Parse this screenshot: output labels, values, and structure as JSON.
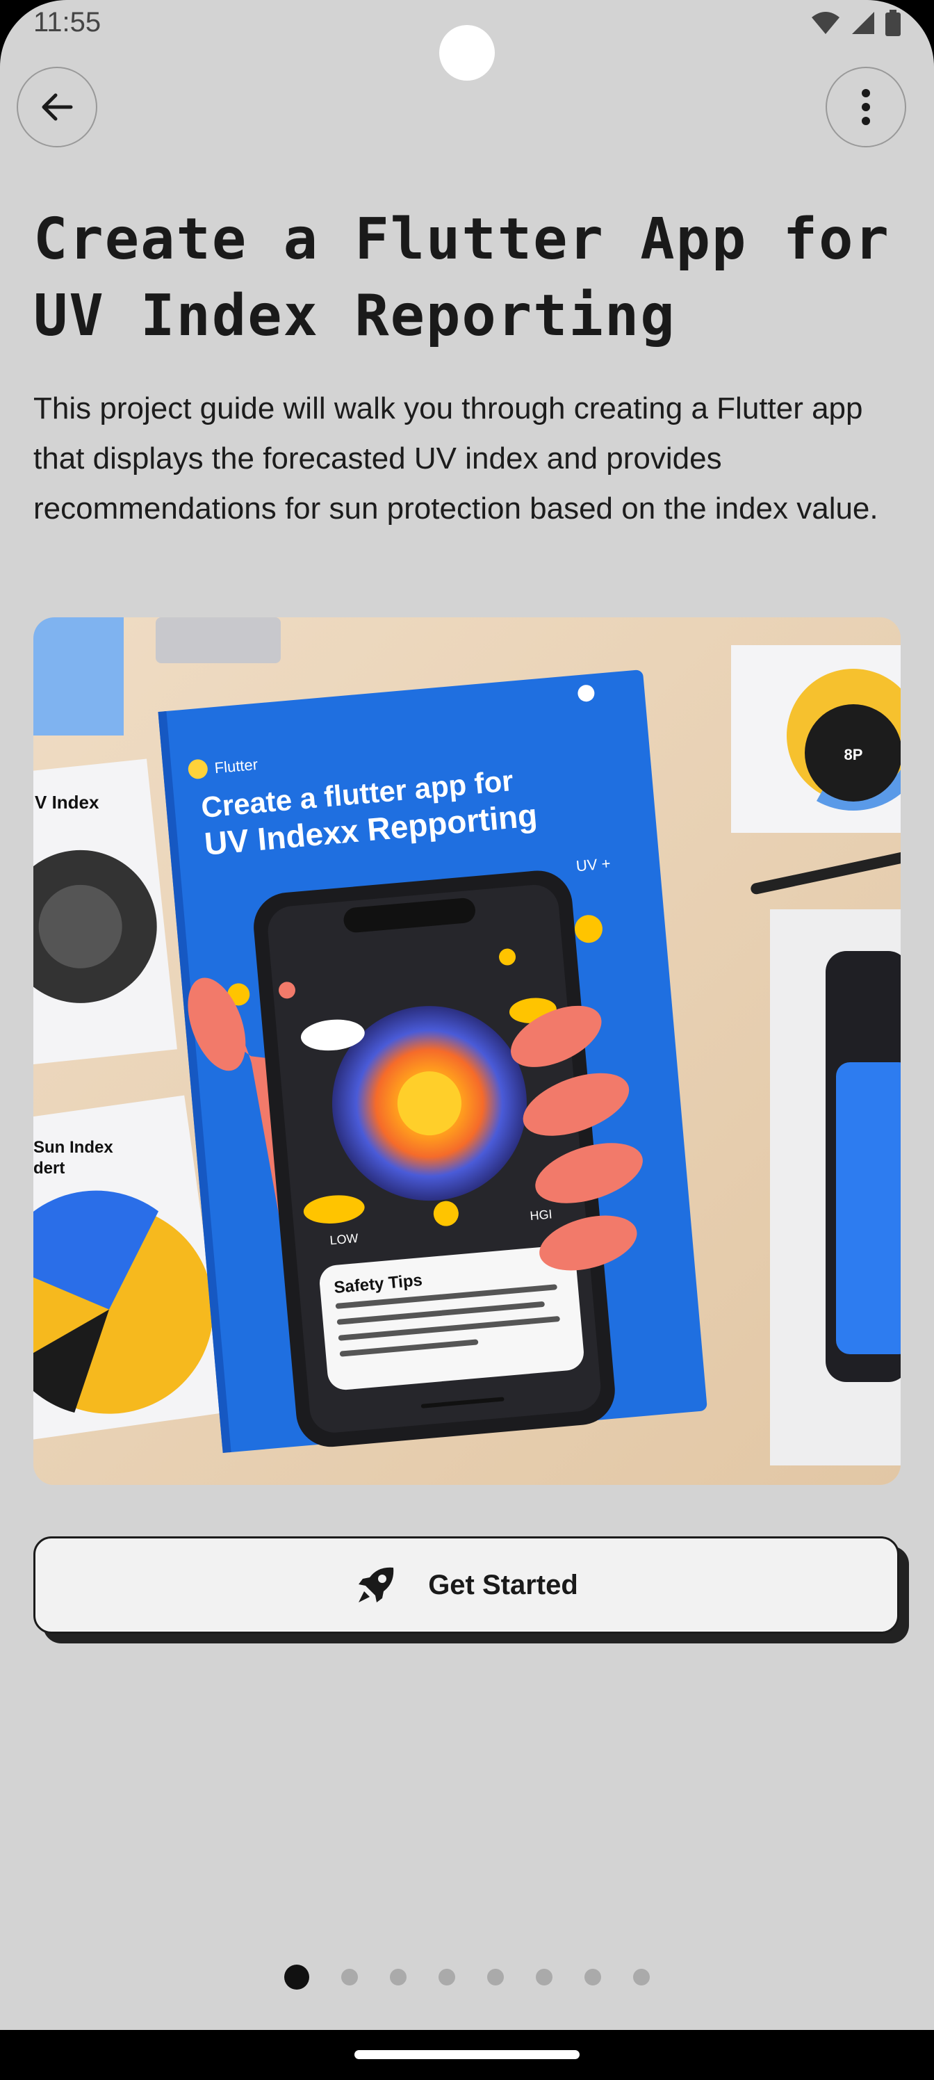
{
  "status": {
    "time": "11:55",
    "icons": [
      "wifi-icon",
      "signal-icon",
      "battery-icon"
    ]
  },
  "header": {
    "back_icon": "arrow-back-icon",
    "more_icon": "more-vert-icon"
  },
  "page": {
    "title_line1": "Create a Flutter App for",
    "title_line2": "UV Index Reporting",
    "description": "This project guide will walk you through creating a Flutter app that displays the forecasted UV index and provides recommendations for sun protection based on the index value."
  },
  "hero_image": {
    "brand": "Flutter",
    "book_title_line1": "Create a flutter app for",
    "book_title_line2": "UV Indexx  Repporting",
    "side_card_left_top": "V Index",
    "side_card_left_bottom_line1": "Sun Index",
    "side_card_left_bottom_line2": "dert",
    "badge": "8P",
    "uv_label": "UV +",
    "phone_scale_low": "LOW",
    "phone_scale_high": "HGI",
    "safety_title": "Safety Tips"
  },
  "cta": {
    "label": "Get Started",
    "icon": "rocket-icon"
  },
  "pager": {
    "count": 8,
    "active": 0
  },
  "colors": {
    "background": "#d3d3d3",
    "accent": "#1f6fe0",
    "text": "#1a1a1a"
  }
}
